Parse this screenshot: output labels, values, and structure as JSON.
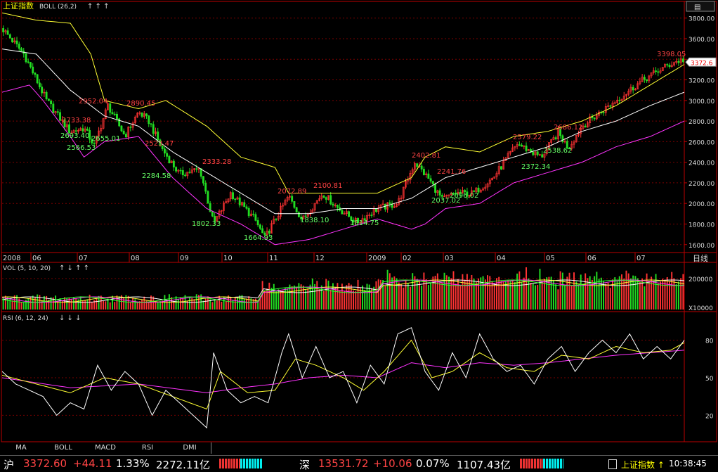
{
  "header": {
    "index_name": "上证指数",
    "indicator": "BOLL (26,2)",
    "arrows": "↑ ↑ ↑"
  },
  "price_panel": {
    "y_ticks": [
      "3800.00",
      "3600.00",
      "3400.00",
      "3200.00",
      "3000.00",
      "2800.00",
      "2600.00",
      "2400.00",
      "2200.00",
      "2000.00",
      "1800.00",
      "1600.00"
    ],
    "last_value": "3372.6",
    "annotations_high": [
      "3398.05",
      "2952.04",
      "2890.45",
      "2733.38",
      "2523.47",
      "2333.28",
      "2072.89",
      "2100.81",
      "2402.81",
      "2241.76",
      "2579.22",
      "2686.12"
    ],
    "annotations_low": [
      "2693.40",
      "2566.53",
      "2655.01",
      "2284.58",
      "1802.33",
      "1664.93",
      "1838.10",
      "1814.75",
      "2037.02",
      "2096.02",
      "2372.34",
      "2538.62"
    ]
  },
  "time_axis": {
    "labels": [
      "2008",
      "06",
      "07",
      "08",
      "09",
      "10",
      "11",
      "12",
      "2009",
      "02",
      "03",
      "04",
      "05",
      "06",
      "07"
    ],
    "period": "日线"
  },
  "vol_panel": {
    "label": "VOL (5, 10, 20)",
    "arrows": "↑ ↓ ↑ ↑",
    "y_tick": "200000",
    "unit": "X10000"
  },
  "rsi_panel": {
    "label": "RSI (6, 12, 24)",
    "arrows": "↓ ↓ ↓",
    "y_ticks": [
      "80",
      "50",
      "20"
    ]
  },
  "tabs": [
    "MA",
    "BOLL",
    "MACD",
    "RSI",
    "DMI"
  ],
  "status": {
    "sh_label": "沪",
    "sh_price": "3372.60",
    "sh_change": "+44.11",
    "sh_pct": "1.33%",
    "sh_amount": "2272.11亿",
    "sz_label": "深",
    "sz_price": "13531.72",
    "sz_change": "+10.06",
    "sz_pct": "0.07%",
    "sz_amount": "1107.43亿",
    "index_name": "上证指数 ↑",
    "time": "10:38:45"
  },
  "chart_data": {
    "type": "candlestick",
    "title": "上证指数",
    "ylim": [
      1530,
      3880
    ],
    "pivots_x": [
      0,
      0.032,
      0.065,
      0.1,
      0.12,
      0.135,
      0.155,
      0.18,
      0.2,
      0.215,
      0.235,
      0.26,
      0.29,
      0.31,
      0.335,
      0.37,
      0.385,
      0.405,
      0.42,
      0.44,
      0.47,
      0.49,
      0.52,
      0.55,
      0.58,
      0.605,
      0.625,
      0.645,
      0.665,
      0.69,
      0.72,
      0.755,
      0.79,
      0.815,
      0.83,
      0.85,
      0.88,
      0.91,
      0.94,
      0.965,
      0.985,
      1
    ],
    "pivots_y": [
      3700,
      3450,
      3000,
      2693,
      2733,
      2566,
      2952,
      2655,
      2890,
      2800,
      2523,
      2284,
      2333,
      1802,
      2100,
      1850,
      1664,
      1900,
      2072,
      1838,
      2100,
      1970,
      1814,
      1950,
      2000,
      2402,
      2241,
      2037,
      2100,
      2096,
      2250,
      2579,
      2450,
      2686,
      2538,
      2750,
      2900,
      3050,
      3200,
      3300,
      3372,
      3398
    ],
    "boll_mid_pts": [
      [
        0,
        3500
      ],
      [
        0.05,
        3450
      ],
      [
        0.1,
        3100
      ],
      [
        0.15,
        2850
      ],
      [
        0.2,
        2750
      ],
      [
        0.25,
        2500
      ],
      [
        0.3,
        2300
      ],
      [
        0.35,
        2100
      ],
      [
        0.4,
        1900
      ],
      [
        0.45,
        1900
      ],
      [
        0.5,
        1950
      ],
      [
        0.55,
        1950
      ],
      [
        0.6,
        2050
      ],
      [
        0.65,
        2250
      ],
      [
        0.7,
        2350
      ],
      [
        0.75,
        2450
      ],
      [
        0.8,
        2550
      ],
      [
        0.85,
        2700
      ],
      [
        0.9,
        2800
      ],
      [
        0.95,
        2950
      ],
      [
        1,
        3080
      ]
    ],
    "boll_up_pts": [
      [
        0,
        3850
      ],
      [
        0.05,
        3780
      ],
      [
        0.1,
        3750
      ],
      [
        0.13,
        3450
      ],
      [
        0.15,
        3000
      ],
      [
        0.2,
        2920
      ],
      [
        0.24,
        3000
      ],
      [
        0.3,
        2750
      ],
      [
        0.35,
        2450
      ],
      [
        0.4,
        2350
      ],
      [
        0.42,
        2100
      ],
      [
        0.5,
        2100
      ],
      [
        0.55,
        2100
      ],
      [
        0.6,
        2250
      ],
      [
        0.62,
        2450
      ],
      [
        0.65,
        2550
      ],
      [
        0.7,
        2500
      ],
      [
        0.75,
        2650
      ],
      [
        0.8,
        2700
      ],
      [
        0.85,
        2800
      ],
      [
        0.9,
        2950
      ],
      [
        0.95,
        3150
      ],
      [
        1,
        3350
      ]
    ],
    "boll_low_pts": [
      [
        0,
        3080
      ],
      [
        0.04,
        3150
      ],
      [
        0.06,
        3000
      ],
      [
        0.1,
        2650
      ],
      [
        0.12,
        2450
      ],
      [
        0.15,
        2600
      ],
      [
        0.2,
        2650
      ],
      [
        0.25,
        2250
      ],
      [
        0.3,
        1950
      ],
      [
        0.35,
        1800
      ],
      [
        0.4,
        1600
      ],
      [
        0.45,
        1650
      ],
      [
        0.5,
        1750
      ],
      [
        0.55,
        1850
      ],
      [
        0.6,
        1750
      ],
      [
        0.62,
        1800
      ],
      [
        0.65,
        1950
      ],
      [
        0.7,
        2000
      ],
      [
        0.75,
        2200
      ],
      [
        0.8,
        2300
      ],
      [
        0.85,
        2400
      ],
      [
        0.9,
        2550
      ],
      [
        0.95,
        2650
      ],
      [
        1,
        2800
      ]
    ],
    "rsi_pts": [
      [
        0,
        55
      ],
      [
        0.02,
        45
      ],
      [
        0.04,
        40
      ],
      [
        0.06,
        35
      ],
      [
        0.08,
        20
      ],
      [
        0.1,
        30
      ],
      [
        0.12,
        25
      ],
      [
        0.14,
        60
      ],
      [
        0.16,
        40
      ],
      [
        0.18,
        55
      ],
      [
        0.2,
        45
      ],
      [
        0.22,
        20
      ],
      [
        0.24,
        40
      ],
      [
        0.26,
        30
      ],
      [
        0.28,
        20
      ],
      [
        0.3,
        10
      ],
      [
        0.31,
        70
      ],
      [
        0.33,
        40
      ],
      [
        0.35,
        30
      ],
      [
        0.37,
        35
      ],
      [
        0.39,
        30
      ],
      [
        0.41,
        70
      ],
      [
        0.42,
        85
      ],
      [
        0.44,
        50
      ],
      [
        0.46,
        75
      ],
      [
        0.48,
        50
      ],
      [
        0.5,
        55
      ],
      [
        0.52,
        30
      ],
      [
        0.54,
        60
      ],
      [
        0.56,
        45
      ],
      [
        0.58,
        85
      ],
      [
        0.6,
        90
      ],
      [
        0.62,
        55
      ],
      [
        0.64,
        40
      ],
      [
        0.66,
        70
      ],
      [
        0.68,
        50
      ],
      [
        0.7,
        85
      ],
      [
        0.72,
        65
      ],
      [
        0.74,
        55
      ],
      [
        0.76,
        60
      ],
      [
        0.78,
        45
      ],
      [
        0.8,
        65
      ],
      [
        0.82,
        75
      ],
      [
        0.84,
        55
      ],
      [
        0.86,
        70
      ],
      [
        0.88,
        80
      ],
      [
        0.9,
        70
      ],
      [
        0.92,
        85
      ],
      [
        0.94,
        65
      ],
      [
        0.96,
        75
      ],
      [
        0.98,
        65
      ],
      [
        1,
        80
      ]
    ],
    "rsi_mid_pts": [
      [
        0,
        52
      ],
      [
        0.05,
        45
      ],
      [
        0.1,
        38
      ],
      [
        0.15,
        50
      ],
      [
        0.2,
        45
      ],
      [
        0.25,
        35
      ],
      [
        0.3,
        25
      ],
      [
        0.32,
        55
      ],
      [
        0.36,
        38
      ],
      [
        0.4,
        40
      ],
      [
        0.43,
        65
      ],
      [
        0.46,
        60
      ],
      [
        0.5,
        50
      ],
      [
        0.53,
        40
      ],
      [
        0.56,
        55
      ],
      [
        0.6,
        80
      ],
      [
        0.63,
        50
      ],
      [
        0.66,
        55
      ],
      [
        0.7,
        70
      ],
      [
        0.74,
        58
      ],
      [
        0.78,
        55
      ],
      [
        0.82,
        68
      ],
      [
        0.86,
        65
      ],
      [
        0.9,
        75
      ],
      [
        0.94,
        70
      ],
      [
        0.98,
        72
      ],
      [
        1,
        78
      ]
    ],
    "rsi_slow_pts": [
      [
        0,
        50
      ],
      [
        0.1,
        42
      ],
      [
        0.2,
        45
      ],
      [
        0.3,
        38
      ],
      [
        0.35,
        42
      ],
      [
        0.4,
        45
      ],
      [
        0.45,
        50
      ],
      [
        0.5,
        52
      ],
      [
        0.55,
        50
      ],
      [
        0.6,
        62
      ],
      [
        0.65,
        58
      ],
      [
        0.7,
        62
      ],
      [
        0.75,
        60
      ],
      [
        0.8,
        62
      ],
      [
        0.85,
        65
      ],
      [
        0.9,
        68
      ],
      [
        0.95,
        70
      ],
      [
        1,
        72
      ]
    ]
  }
}
